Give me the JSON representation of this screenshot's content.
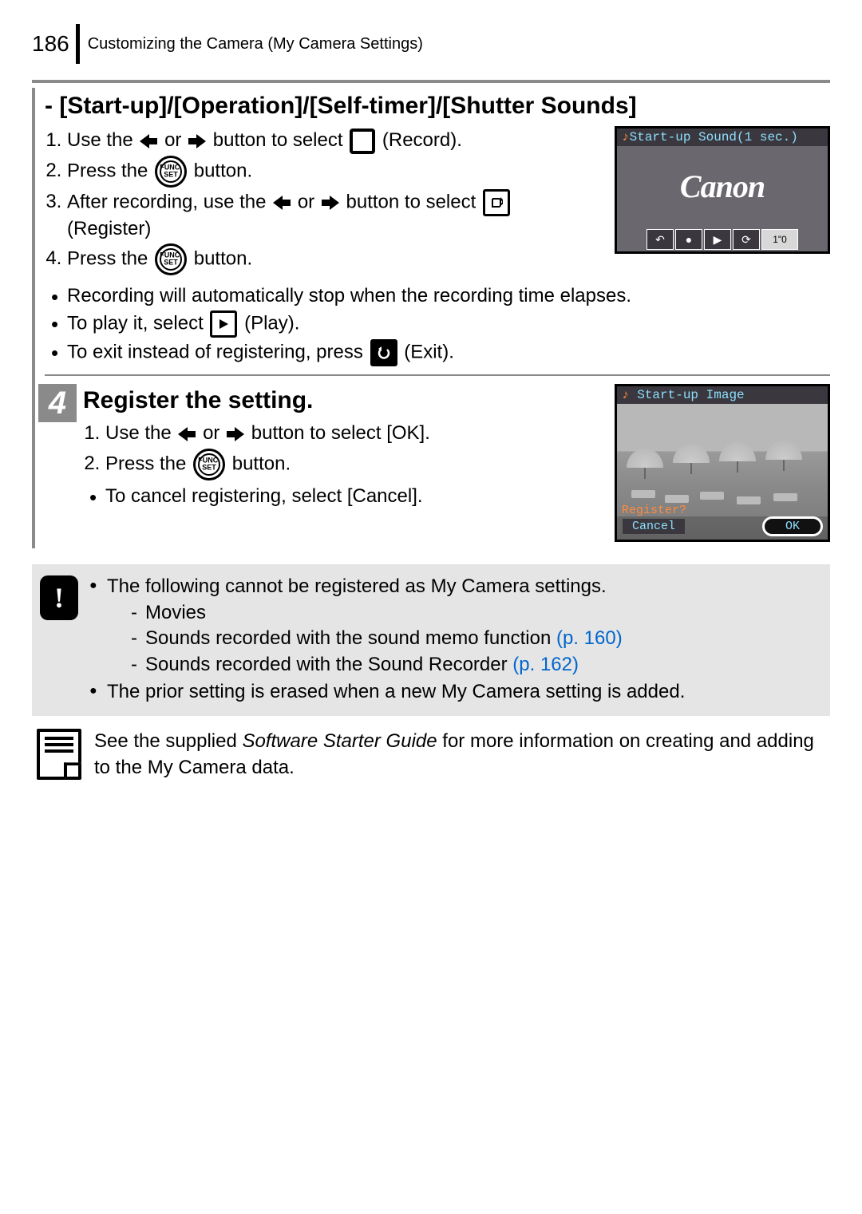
{
  "header": {
    "page_number": "186",
    "title": "Customizing the Camera (My Camera Settings)"
  },
  "section1": {
    "title": "- [Start-up]/[Operation]/[Self-timer]/[Shutter Sounds]",
    "steps": {
      "s1a": "Use the ",
      "s1b": " or ",
      "s1c": " button to select ",
      "s1d": " (Record).",
      "s2a": "Press the ",
      "s2b": " button.",
      "s3a": "After recording, use the ",
      "s3b": " or ",
      "s3c": " button to select ",
      "s3d": " (Register)",
      "s4a": "Press the ",
      "s4b": " button."
    },
    "bullets": {
      "b1": "Recording will automatically stop when the recording time elapses.",
      "b2a": "To play it, select ",
      "b2b": " (Play).",
      "b3a": "To exit instead of registering, press ",
      "b3b": " (Exit)."
    },
    "screen": {
      "top": "Start-up Sound(1 sec.)",
      "brand": "Canon",
      "timer": "1\"0"
    }
  },
  "section2": {
    "number": "4",
    "heading": "Register the setting.",
    "steps": {
      "s1a": "Use the ",
      "s1b": " or ",
      "s1c": " button to select [OK].",
      "s2a": "Press the ",
      "s2b": " button."
    },
    "bullets": {
      "b1": "To cancel registering, select [Cancel]."
    },
    "screen": {
      "top": "Start-up Image",
      "register_q": "Register?",
      "cancel": "Cancel",
      "ok": "OK"
    }
  },
  "warning": {
    "line1": "The following cannot be registered as My Camera settings.",
    "d1": "Movies",
    "d2a": "Sounds recorded with the sound memo function ",
    "d2b": "(p. 160)",
    "d3a": "Sounds recorded with the Sound Recorder ",
    "d3b": "(p. 162)",
    "line2": "The prior setting is erased when a new My Camera setting is added."
  },
  "note": {
    "text_a": "See the supplied ",
    "text_em": "Software Starter Guide",
    "text_b": " for more information on creating and adding to the My Camera data."
  },
  "icons": {
    "funcset": "FUNC.\nSET"
  }
}
